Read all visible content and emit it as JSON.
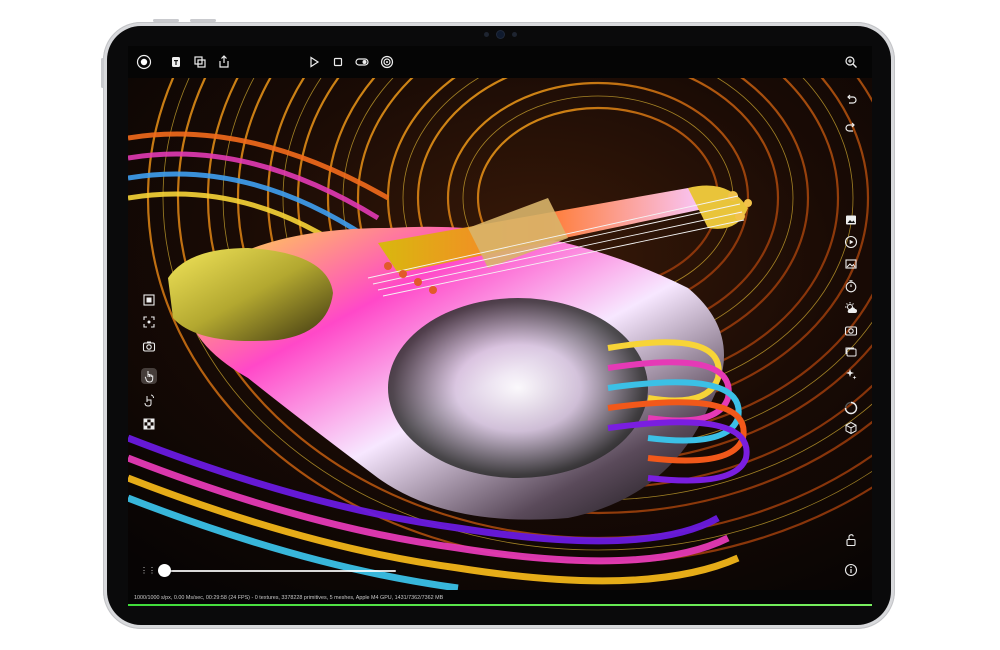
{
  "device": {
    "name": "iPad"
  },
  "top_toolbar": {
    "left_icons": [
      "record-icon",
      "text-icon",
      "layers-icon",
      "share-icon"
    ],
    "center_icons": [
      "play-icon",
      "stop-icon",
      "toggle-icon",
      "target-icon"
    ],
    "right_icons": [
      "zoom-icon"
    ]
  },
  "left_toolbar": {
    "icons": [
      "frame-select-icon",
      "focus-icon",
      "camera-icon",
      "touch-icon",
      "gesture-icon",
      "checkerboard-icon"
    ],
    "active": "touch-icon"
  },
  "right_toolbar": {
    "icons": [
      "undo-icon",
      "redo-icon",
      "image-icon",
      "play-circle-icon",
      "picture-icon",
      "timer-icon",
      "weather-icon",
      "camera-icon",
      "photos-icon",
      "sparkle-icon",
      "circle-progress-icon",
      "cube-icon",
      "unlock-icon",
      "info-icon"
    ]
  },
  "timeline": {
    "progress": 0.0
  },
  "status_text": "1000/1000 s/px, 0.00 Ms/sec, 00:29:58 (24 FPS) - 0 textures, 3378228 primitives, 5 meshes, Apple M4 GPU, 1431/7362/7362 MB",
  "render": {
    "scene": "violin",
    "accent_colors": [
      "#f2b51a",
      "#e8478d",
      "#3bc0e6",
      "#7a1ee0"
    ]
  }
}
